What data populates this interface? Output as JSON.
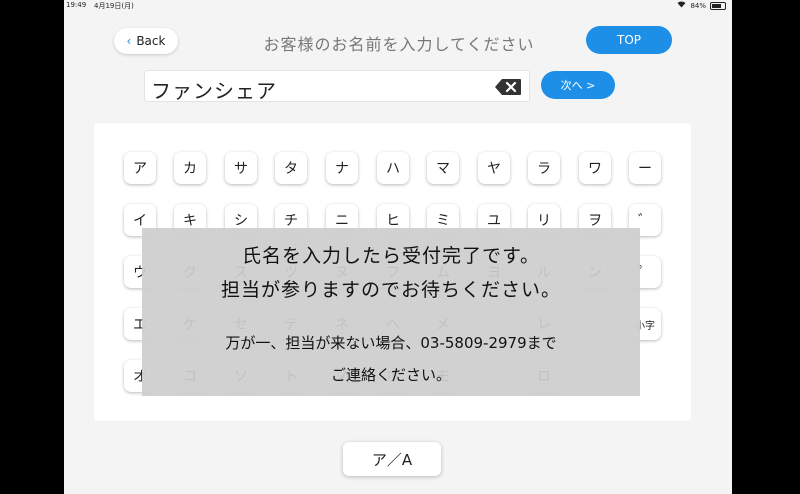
{
  "status_bar": {
    "time": "19:49",
    "date": "4月19日(月)",
    "battery": "84%",
    "wifi_icon": "wifi-icon",
    "battery_icon": "battery-icon"
  },
  "header": {
    "back_label": "Back",
    "title": "お客様のお名前を入力してください",
    "top_label": "TOP"
  },
  "name_field": {
    "value": "ファンシェア",
    "clear_icon": "backspace-icon"
  },
  "next_button": {
    "label": "次へ >"
  },
  "keyboard": {
    "rows": [
      [
        "ア",
        "カ",
        "サ",
        "タ",
        "ナ",
        "ハ",
        "マ",
        "ヤ",
        "ラ",
        "ワ",
        "ー"
      ],
      [
        "イ",
        "キ",
        "シ",
        "チ",
        "ニ",
        "ヒ",
        "ミ",
        "ユ",
        "リ",
        "ヲ",
        "゛"
      ],
      [
        "ウ",
        "ク",
        "ス",
        "ツ",
        "ヌ",
        "フ",
        "ム",
        "ヨ",
        "ル",
        "ン",
        "゜"
      ],
      [
        "エ",
        "ケ",
        "セ",
        "テ",
        "ネ",
        "ヘ",
        "メ",
        "",
        "レ",
        "",
        "小字"
      ],
      [
        "オ",
        "コ",
        "ソ",
        "ト",
        "ノ",
        "ホ",
        "モ",
        "",
        "ロ",
        "",
        ""
      ]
    ]
  },
  "overlay": {
    "line1": "氏名を入力したら受付完了です。",
    "line2": "担当が参りますのでお待ちください。",
    "line3": "万が一、担当が来ない場合、03-5809-2979まで",
    "line4": "ご連絡ください。"
  },
  "mode_toggle": {
    "label": "ア／A"
  },
  "colors": {
    "accent": "#1d8fe6",
    "background": "#f4f4f5",
    "overlay": "#cdcdcd"
  }
}
